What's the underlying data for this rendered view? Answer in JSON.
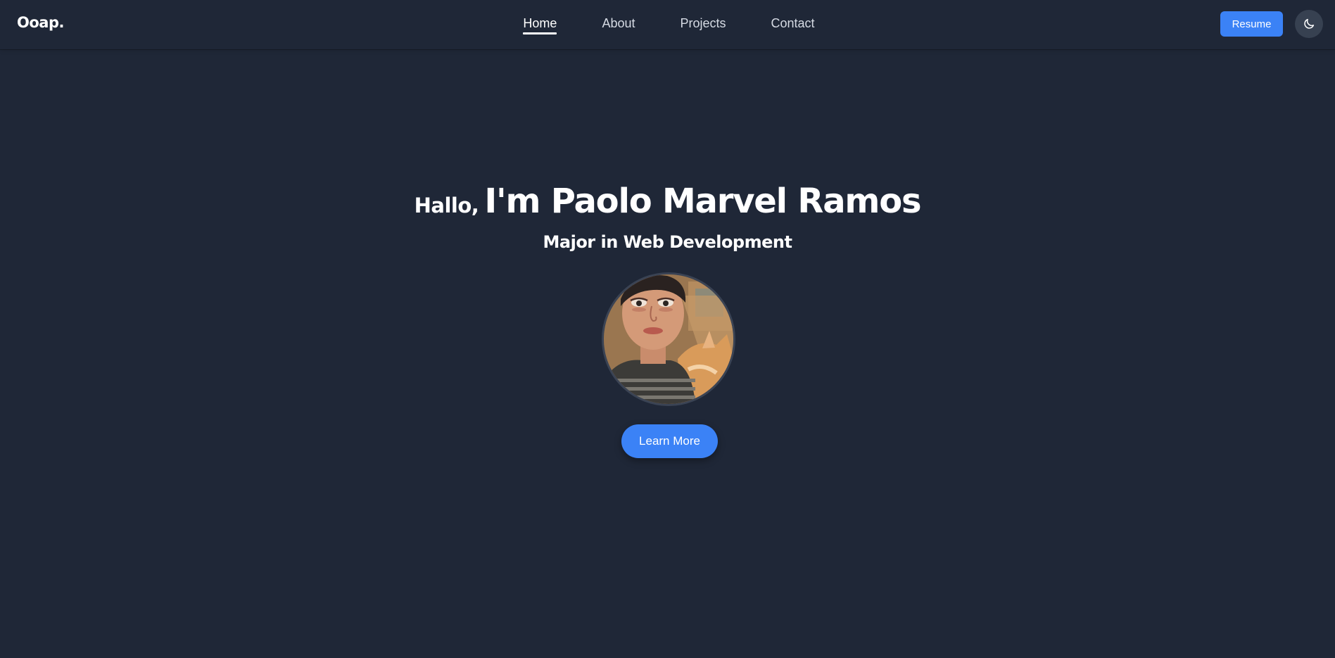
{
  "brand": {
    "logo": "Ooap."
  },
  "nav": {
    "links": [
      {
        "label": "Home",
        "active": true
      },
      {
        "label": "About",
        "active": false
      },
      {
        "label": "Projects",
        "active": false
      },
      {
        "label": "Contact",
        "active": false
      }
    ],
    "resume_label": "Resume",
    "theme_toggle_icon": "moon-icon"
  },
  "hero": {
    "greeting": "Hallo,",
    "name": "I'm Paolo Marvel Ramos",
    "subtitle": "Major in Web Development",
    "avatar_icon": "profile-illustration",
    "cta_label": "Learn More"
  },
  "colors": {
    "background": "#1f2737",
    "accent": "#3b82f6",
    "toggle_bg": "#374151",
    "text": "#ffffff"
  }
}
